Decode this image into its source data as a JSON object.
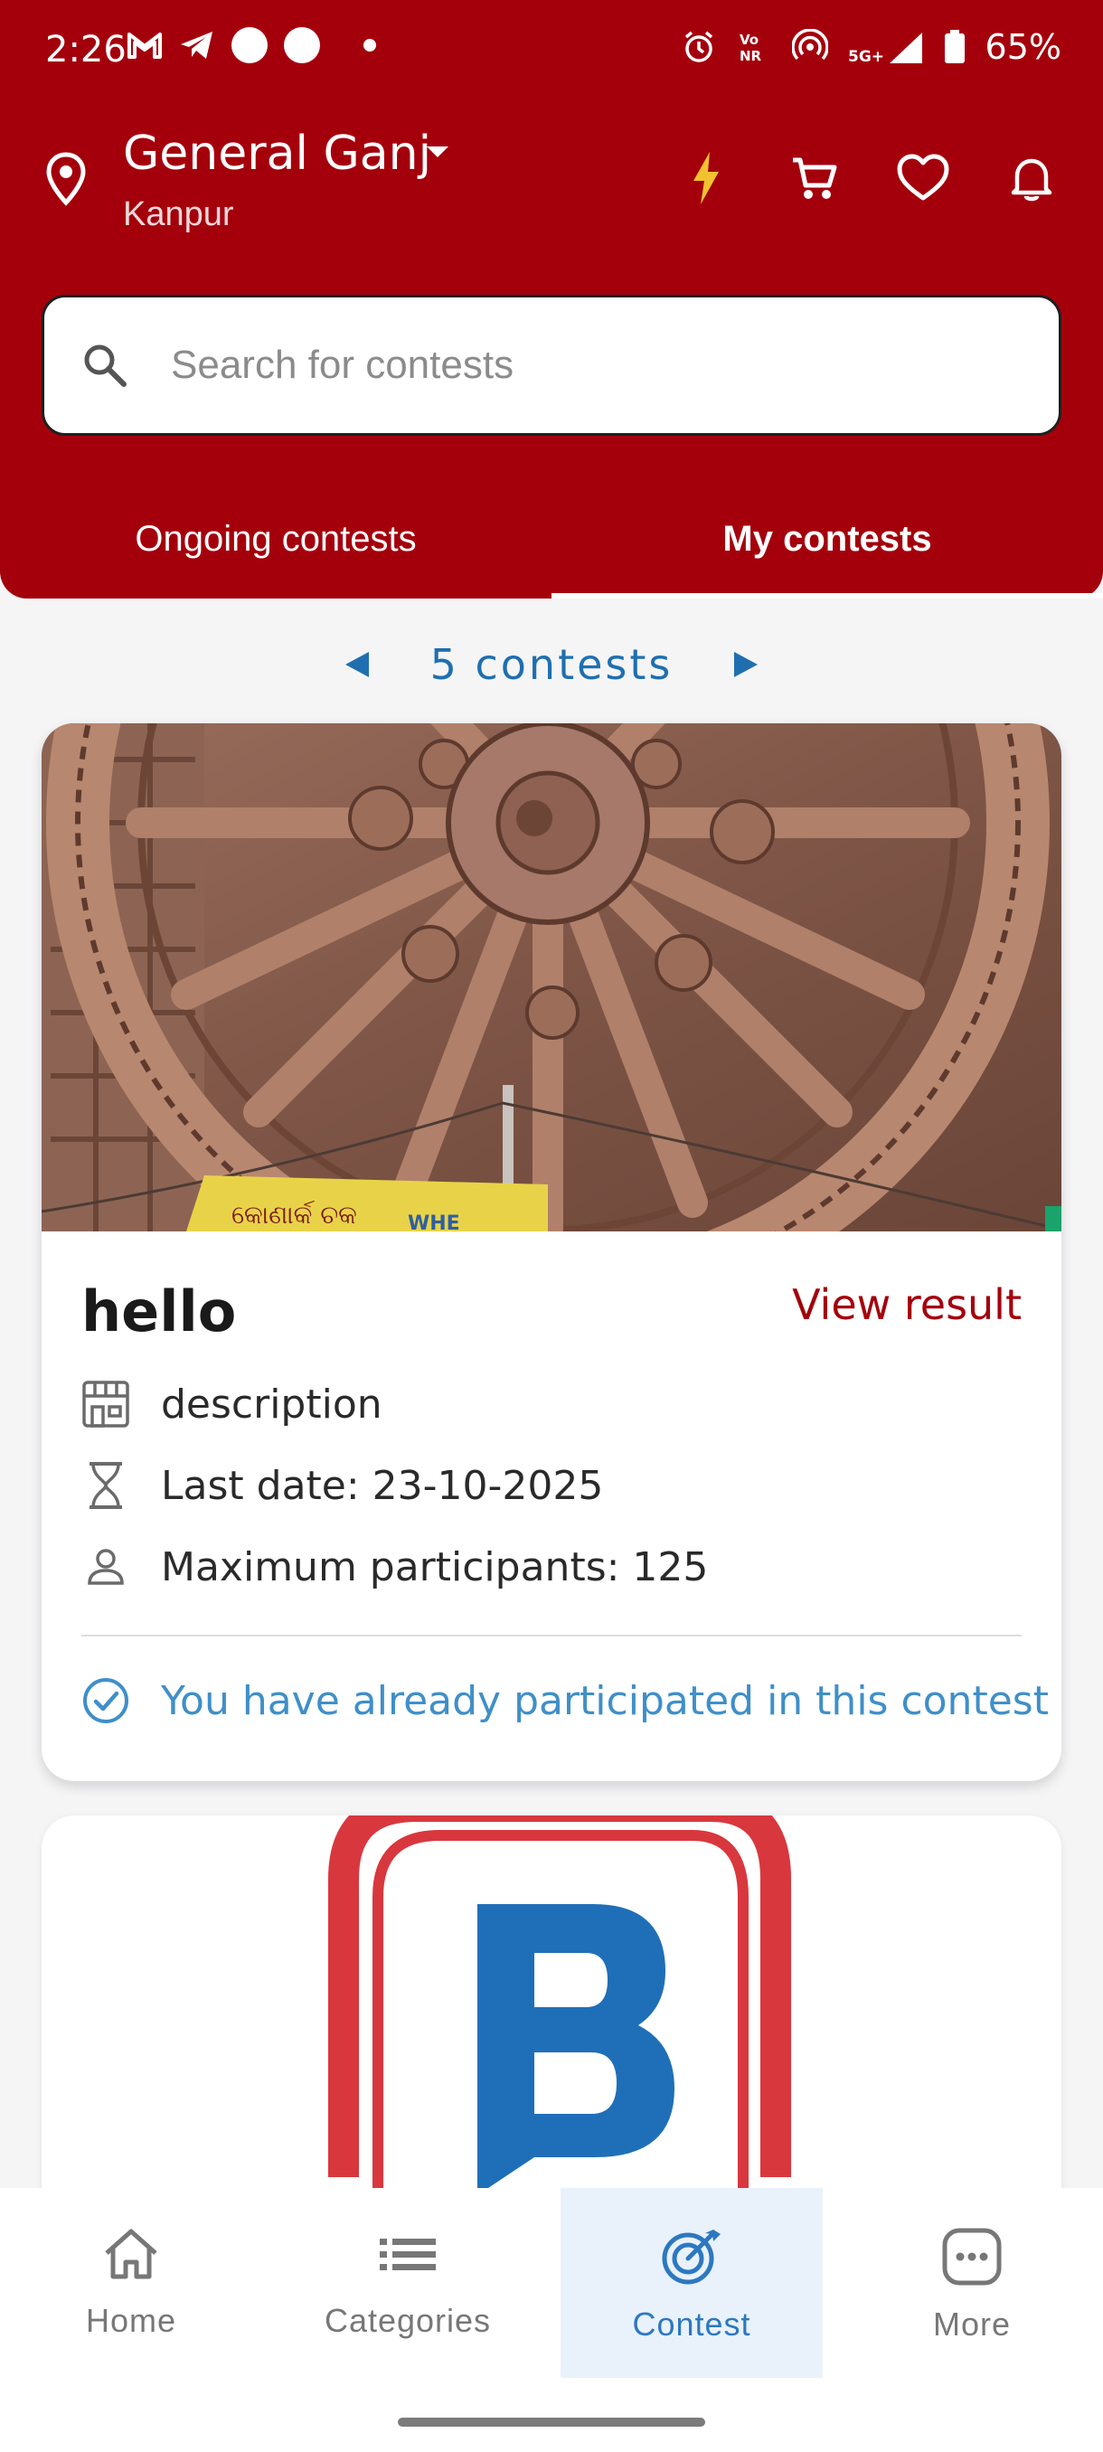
{
  "status_bar": {
    "time": "2:26",
    "battery": "65%",
    "network": "5G+",
    "volte": "Vo NR"
  },
  "header": {
    "location_title": "General Ganj",
    "location_subtitle": "Kanpur",
    "icons": [
      "location-pin-icon",
      "caret-down-icon",
      "flash-icon",
      "cart-icon",
      "heart-icon",
      "bell-icon"
    ]
  },
  "search": {
    "placeholder": "Search for contests"
  },
  "tabs": {
    "ongoing": "Ongoing contests",
    "mine": "My contests",
    "active": "My contests"
  },
  "pager": {
    "label": "5 contests"
  },
  "contests": [
    {
      "title": "hello",
      "action": "View result",
      "description": "description",
      "last_date": "Last date: 23-10-2025",
      "max_participants": "Maximum participants: 125",
      "status": "You have already participated in this contest",
      "image": "konark-wheel-photo"
    },
    {
      "image": "brand-logo-B"
    }
  ],
  "bottom_nav": {
    "items": [
      {
        "label": "Home",
        "icon": "home-icon"
      },
      {
        "label": "Categories",
        "icon": "list-icon"
      },
      {
        "label": "Contest",
        "icon": "target-icon"
      },
      {
        "label": "More",
        "icon": "more-icon"
      }
    ],
    "active": "Contest"
  },
  "colors": {
    "brand_red": "#a4000c",
    "accent_blue": "#1f6fb0",
    "status_blue": "#3f8fc9"
  }
}
